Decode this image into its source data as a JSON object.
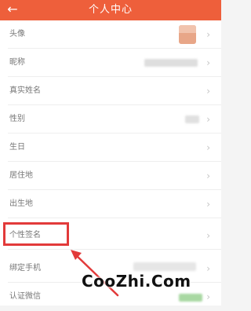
{
  "header": {
    "title": "个人中心",
    "back_icon": "arrow-left-icon"
  },
  "rows": [
    {
      "label": "头像"
    },
    {
      "label": "昵称"
    },
    {
      "label": "真实姓名"
    },
    {
      "label": "性别"
    },
    {
      "label": "生日"
    },
    {
      "label": "居住地"
    },
    {
      "label": "出生地"
    },
    {
      "label": "个性签名"
    },
    {
      "label": "绑定手机"
    },
    {
      "label": "认证微信"
    }
  ],
  "chevron": "›",
  "watermark": "CooZhi.Com",
  "colors": {
    "header": "#ee5f3b",
    "highlight": "#e23a3a"
  }
}
